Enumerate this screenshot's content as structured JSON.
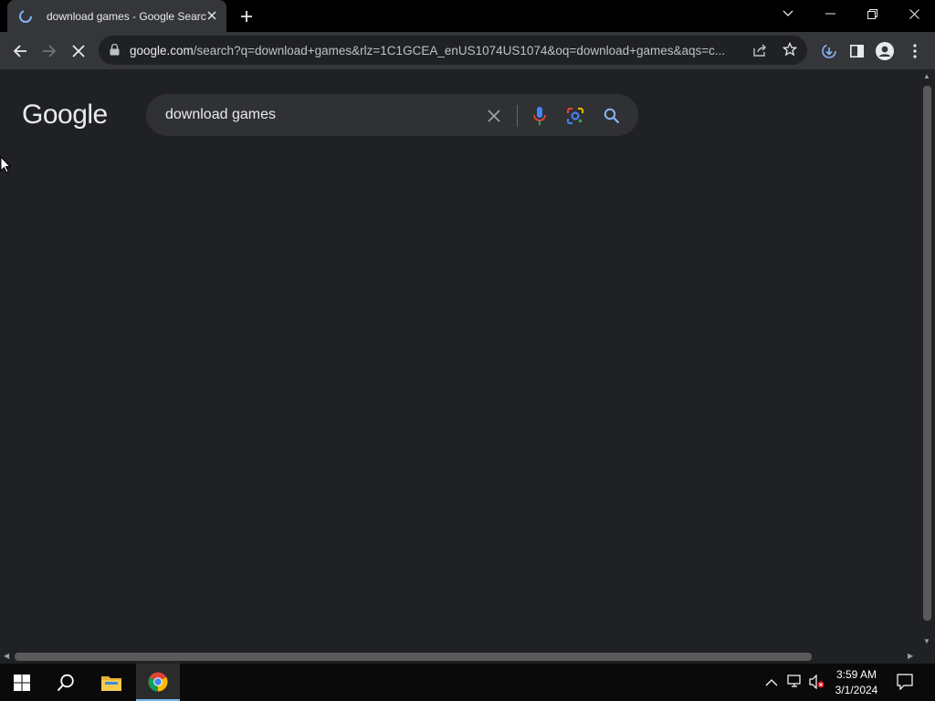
{
  "tab": {
    "title": "download games - Google Search"
  },
  "window_controls": {
    "list": "tab-search",
    "minimize": "minimize",
    "restore": "restore",
    "close": "close"
  },
  "omnibox": {
    "host": "google.com",
    "path": "/search?q=download+games&rlz=1C1GCEA_enUS1074US1074&oq=download+games&aqs=c..."
  },
  "page": {
    "logo": "Google",
    "search_value": "download games"
  },
  "taskbar": {
    "time": "3:59 AM",
    "date": "3/1/2024"
  },
  "colors": {
    "page_bg": "#202124",
    "toolbar_bg": "#35363a",
    "searchbox_bg": "#303134"
  }
}
